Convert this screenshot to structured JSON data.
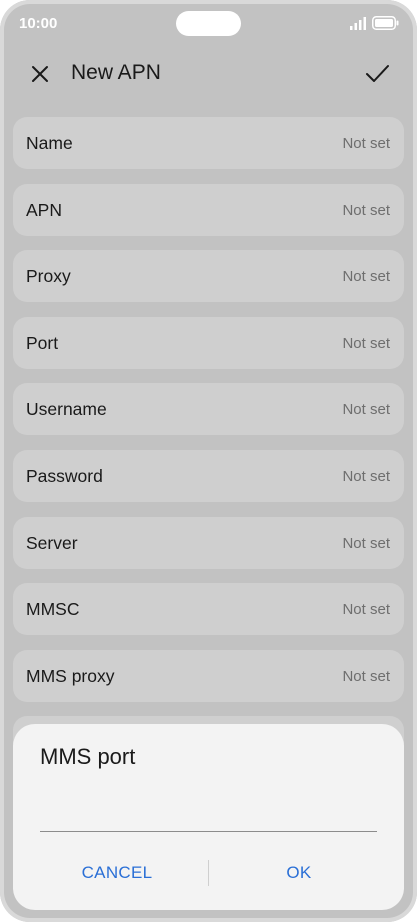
{
  "status": {
    "time": "10:00",
    "signal_icon": "signal-icon",
    "battery_icon": "battery-icon"
  },
  "header": {
    "title": "New APN",
    "close_icon": "close-icon",
    "confirm_icon": "checkmark-icon"
  },
  "settings": [
    {
      "label": "Name",
      "value": "Not set"
    },
    {
      "label": "APN",
      "value": "Not set"
    },
    {
      "label": "Proxy",
      "value": "Not set"
    },
    {
      "label": "Port",
      "value": "Not set"
    },
    {
      "label": "Username",
      "value": "Not set"
    },
    {
      "label": "Password",
      "value": "Not set"
    },
    {
      "label": "Server",
      "value": "Not set"
    },
    {
      "label": "MMSC",
      "value": "Not set"
    },
    {
      "label": "MMS proxy",
      "value": "Not set"
    }
  ],
  "dialog": {
    "title": "MMS port",
    "input_value": "",
    "cancel_label": "CANCEL",
    "ok_label": "OK"
  },
  "colors": {
    "accent": "#2a6fd6",
    "background_dimmed": "#c2c2c2",
    "dialog_background": "#f3f3f3"
  }
}
